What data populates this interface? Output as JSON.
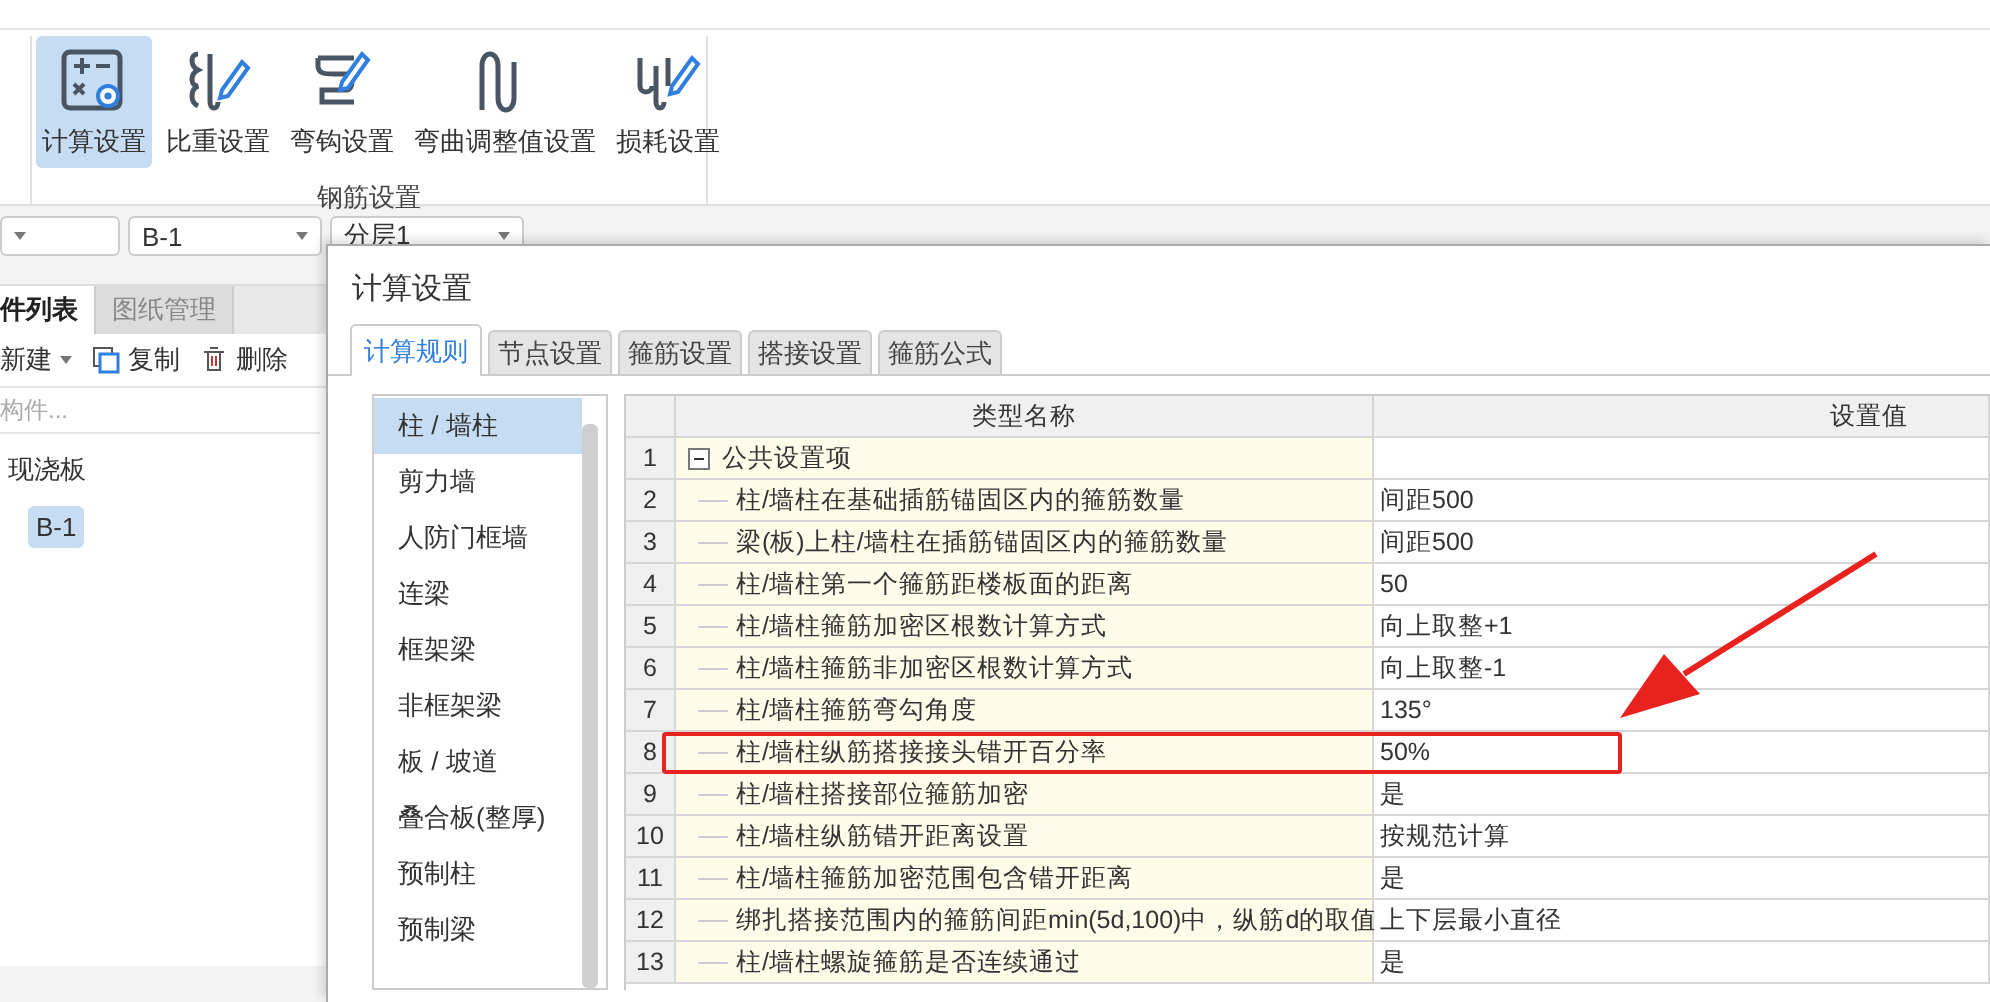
{
  "ribbon": {
    "buttons": [
      {
        "label": "计算设置",
        "selected": true
      },
      {
        "label": "比重设置",
        "selected": false
      },
      {
        "label": "弯钩设置",
        "selected": false
      },
      {
        "label": "弯曲调整值设置",
        "selected": false
      },
      {
        "label": "损耗设置",
        "selected": false
      }
    ],
    "group_label": "钢筋设置"
  },
  "selectors": [
    "B-1",
    "分层1"
  ],
  "left_panel": {
    "tabs": [
      {
        "label": "件列表",
        "selected": true
      },
      {
        "label": "图纸管理",
        "selected": false
      }
    ],
    "toolbar": [
      "新建",
      "复制",
      "删除"
    ],
    "search": {
      "placeholder": "构件..."
    },
    "tree": [
      {
        "label": "现浇板",
        "selected": false,
        "children": [
          {
            "label": "B-1",
            "selected": true
          }
        ]
      }
    ]
  },
  "dialog": {
    "title": "计算设置",
    "tabs": [
      {
        "label": "计算规则",
        "selected": true
      },
      {
        "label": "节点设置",
        "selected": false
      },
      {
        "label": "箍筋设置",
        "selected": false
      },
      {
        "label": "搭接设置",
        "selected": false
      },
      {
        "label": "箍筋公式",
        "selected": false
      }
    ],
    "categories": [
      {
        "label": "柱 / 墙柱",
        "selected": true
      },
      {
        "label": "剪力墙",
        "selected": false
      },
      {
        "label": "人防门框墙",
        "selected": false
      },
      {
        "label": "连梁",
        "selected": false
      },
      {
        "label": "框架梁",
        "selected": false
      },
      {
        "label": "非框架梁",
        "selected": false
      },
      {
        "label": "板 / 坡道",
        "selected": false
      },
      {
        "label": "叠合板(整厚)",
        "selected": false
      },
      {
        "label": "预制柱",
        "selected": false
      },
      {
        "label": "预制梁",
        "selected": false
      }
    ],
    "table": {
      "columns": [
        "类型名称",
        "设置值"
      ],
      "rows": [
        {
          "number": "1",
          "kind": "group",
          "name": "公共设置项",
          "expanded": true
        },
        {
          "number": "2",
          "kind": "item",
          "name": "柱/墙柱在基础插筋锚固区内的箍筋数量",
          "value": "间距500",
          "highlighted": false
        },
        {
          "number": "3",
          "kind": "item",
          "name": "梁(板)上柱/墙柱在插筋锚固区内的箍筋数量",
          "value": "间距500",
          "highlighted": false
        },
        {
          "number": "4",
          "kind": "item",
          "name": "柱/墙柱第一个箍筋距楼板面的距离",
          "value": "50",
          "highlighted": false
        },
        {
          "number": "5",
          "kind": "item",
          "name": "柱/墙柱箍筋加密区根数计算方式",
          "value": "向上取整+1",
          "highlighted": false
        },
        {
          "number": "6",
          "kind": "item",
          "name": "柱/墙柱箍筋非加密区根数计算方式",
          "value": "向上取整-1",
          "highlighted": false
        },
        {
          "number": "7",
          "kind": "item",
          "name": "柱/墙柱箍筋弯勾角度",
          "value": "135°",
          "highlighted": false
        },
        {
          "number": "8",
          "kind": "item",
          "name": "柱/墙柱纵筋搭接接头错开百分率",
          "value": "50%",
          "highlighted": true
        },
        {
          "number": "9",
          "kind": "item",
          "name": "柱/墙柱搭接部位箍筋加密",
          "value": "是",
          "highlighted": false
        },
        {
          "number": "10",
          "kind": "item",
          "name": "柱/墙柱纵筋错开距离设置",
          "value": "按规范计算",
          "highlighted": false
        },
        {
          "number": "11",
          "kind": "item",
          "name": "柱/墙柱箍筋加密范围包含错开距离",
          "value": "是",
          "highlighted": false
        },
        {
          "number": "12",
          "kind": "item",
          "name": "绑扎搭接范围内的箍筋间距min(5d,100)中，纵筋d的取值",
          "value": "上下层最小直径",
          "highlighted": false
        },
        {
          "number": "13",
          "kind": "item",
          "name": "柱/墙柱螺旋箍筋是否连续通过",
          "value": "是",
          "highlighted": false
        }
      ]
    }
  }
}
